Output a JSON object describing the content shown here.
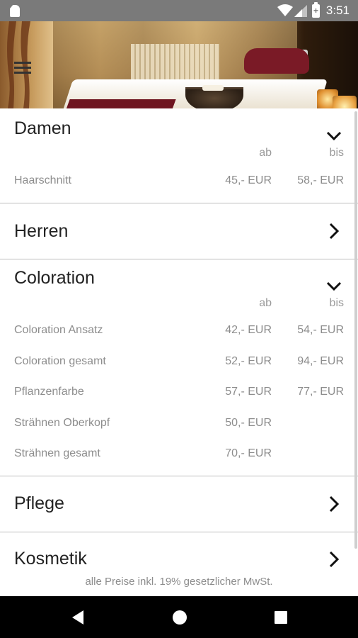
{
  "status_bar": {
    "time": "3:51",
    "battery_glyph": "+",
    "icons": [
      "sd-card-icon",
      "wifi-icon",
      "signal-icon",
      "battery-charging-icon"
    ]
  },
  "header": {
    "menu_icon": "hamburger-menu-icon"
  },
  "sections": [
    {
      "title": "Damen",
      "expanded": true,
      "col_ab": "ab",
      "col_bis": "bis",
      "rows": [
        {
          "name": "Haarschnitt",
          "ab": "45,- EUR",
          "bis": "58,- EUR"
        }
      ]
    },
    {
      "title": "Herren",
      "expanded": false
    },
    {
      "title": "Coloration",
      "expanded": true,
      "col_ab": "ab",
      "col_bis": "bis",
      "rows": [
        {
          "name": "Coloration Ansatz",
          "ab": "42,- EUR",
          "bis": "54,- EUR"
        },
        {
          "name": "Coloration gesamt",
          "ab": "52,- EUR",
          "bis": "94,- EUR"
        },
        {
          "name": "Pflanzenfarbe",
          "ab": "57,- EUR",
          "bis": "77,- EUR"
        },
        {
          "name": "Strähnen Oberkopf",
          "ab": "50,- EUR",
          "bis": ""
        },
        {
          "name": "Strähnen gesamt",
          "ab": "70,- EUR",
          "bis": ""
        }
      ]
    },
    {
      "title": "Pflege",
      "expanded": false
    },
    {
      "title": "Kosmetik",
      "expanded": false
    }
  ],
  "footnote": "alle Preise inkl. 19% gesetzlicher MwSt.",
  "nav_bar": {
    "icons": [
      "back-icon",
      "home-icon",
      "recents-icon"
    ]
  },
  "colors": {
    "status_bar": "#7a7a7a",
    "nav_bar": "#000000",
    "title_text": "#222222",
    "secondary_text": "#8d8d8d",
    "divider": "#bdbdbd"
  }
}
